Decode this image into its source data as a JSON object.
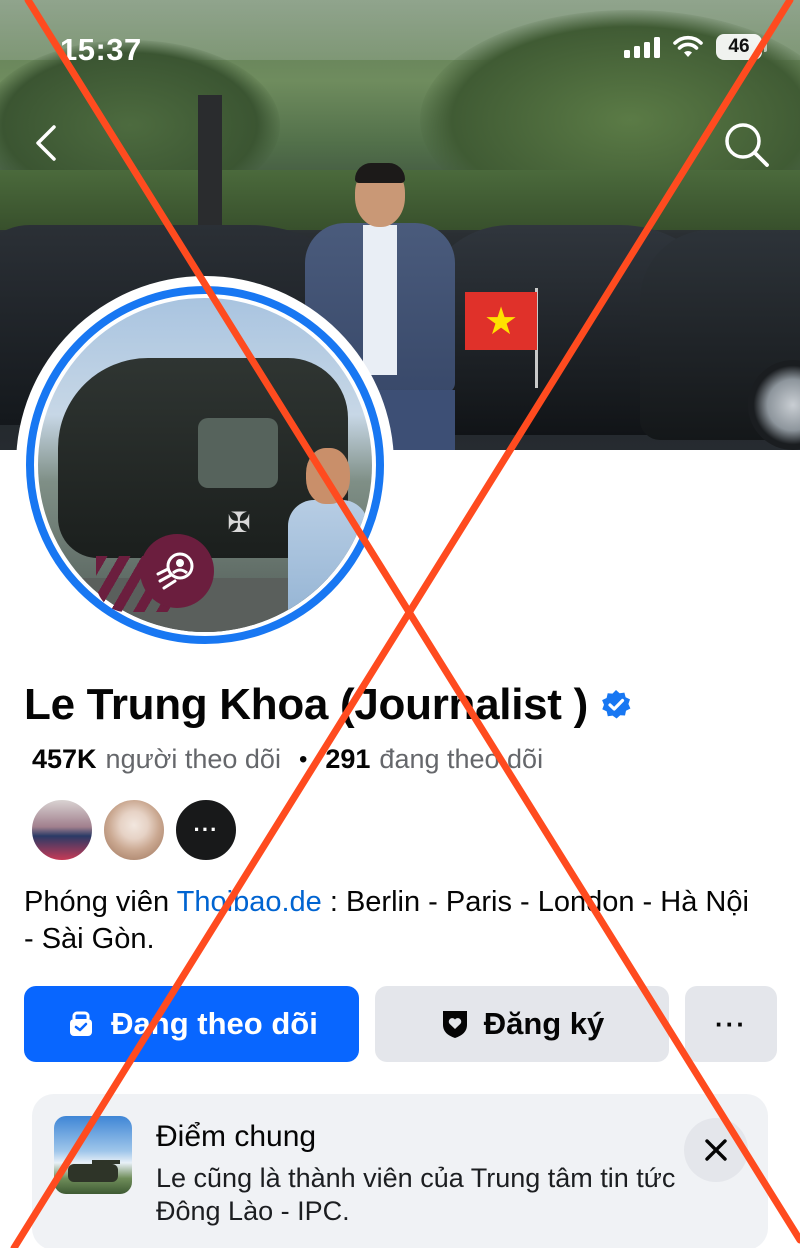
{
  "status_bar": {
    "time": "15:37",
    "battery": "46",
    "icons": [
      "cellular-signal-icon",
      "wifi-icon",
      "battery-icon"
    ]
  },
  "nav": {
    "back_icon": "chevron-left-icon",
    "search_icon": "search-icon"
  },
  "profile": {
    "name": "Le Trung Khoa (Journalist )",
    "verified_icon": "verified-badge-icon",
    "followers_count": "457K",
    "followers_label": "người theo dõi",
    "separator": "•",
    "following_count": "291",
    "following_label": "đang theo dõi",
    "mutual_more": "···",
    "bio_prefix": "Phóng viên ",
    "bio_link": "Thoibao.de",
    "bio_suffix": " : Berlin - Paris - London - Hà Nội - Sài Gòn."
  },
  "actions": {
    "follow_label": "Đang theo dõi",
    "subscribe_label": "Đăng ký",
    "more_label": "···"
  },
  "common_card": {
    "title": "Điểm chung",
    "text": "Le cũng là thành viên của Trung tâm tin tức Đông Lào - IPC.",
    "close_icon": "close-icon"
  },
  "colors": {
    "accent": "#0866ff",
    "avatar_ring": "#1877f2",
    "link": "#0064d1",
    "cross_overlay": "#ff4b1f",
    "secondary_button": "#e4e6eb"
  }
}
